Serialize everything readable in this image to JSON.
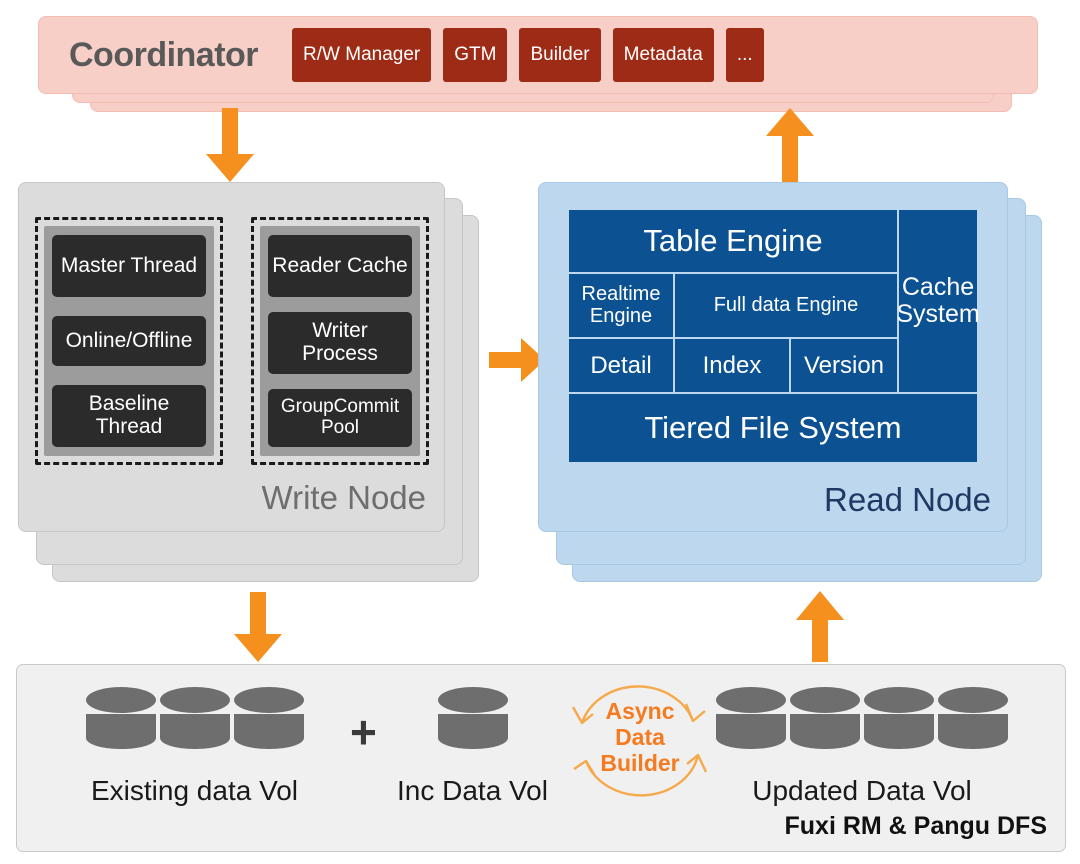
{
  "diagram": {
    "accent_orange": "#F5901F",
    "coordinator": {
      "title": "Coordinator",
      "chips": [
        "R/W Manager",
        "GTM",
        "Builder",
        "Metadata",
        "..."
      ]
    },
    "write_node": {
      "label": "Write Node",
      "group_left": [
        "Master Thread",
        "Online/Offline",
        "Baseline Thread"
      ],
      "group_right": [
        "Reader Cache",
        "Writer Process",
        "GroupCommit Pool"
      ]
    },
    "read_node": {
      "label": "Read Node",
      "cells": {
        "table_engine": "Table Engine",
        "realtime_engine": "Realtime Engine",
        "full_data_engine": "Full data Engine",
        "detail": "Detail",
        "index": "Index",
        "version": "Version",
        "cache_system": "Cache System",
        "tiered_file_system": "Tiered File System"
      }
    },
    "storage": {
      "existing_label": "Existing data Vol",
      "existing_count": 3,
      "plus": "+",
      "inc_label": "Inc Data Vol",
      "inc_count": 1,
      "updated_label": "Updated Data Vol",
      "updated_count": 4,
      "async_builder": "Async\nData\nBuilder",
      "async_line1": "Async",
      "async_line2": "Data",
      "async_line3": "Builder",
      "footer": "Fuxi RM & Pangu DFS"
    },
    "arrows": {
      "coordinator_to_write": "down-arrow-icon",
      "read_to_coordinator": "up-arrow-icon",
      "write_to_read": "right-arrow-icon",
      "write_to_storage": "down-arrow-icon",
      "storage_to_read": "up-arrow-icon"
    }
  }
}
